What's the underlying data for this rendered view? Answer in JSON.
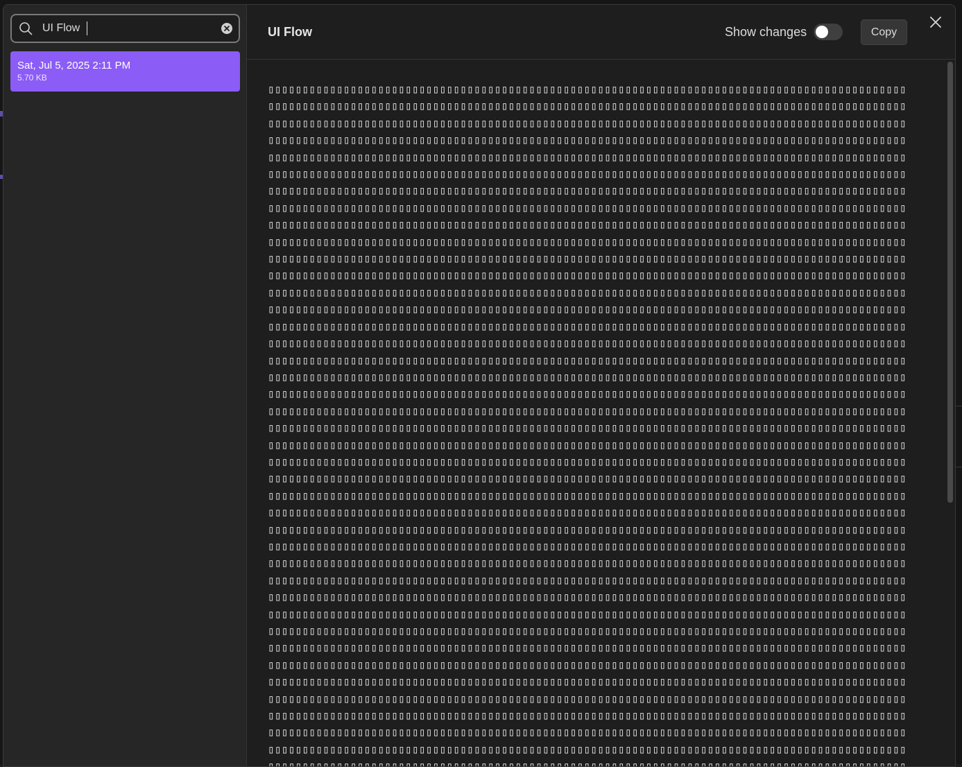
{
  "search": {
    "value": "UI Flow",
    "placeholder": "Search"
  },
  "history": {
    "items": [
      {
        "date": "Sat, Jul 5, 2025 2:11 PM",
        "size": "5.70 KB",
        "selected": true
      }
    ]
  },
  "header": {
    "title": "UI Flow",
    "show_changes_label": "Show changes",
    "show_changes_on": false,
    "copy_label": "Copy"
  },
  "content": {
    "text": "▯▯▯▯▯▯▯▯▯▯▯▯▯▯▯▯▯▯▯▯▯▯▯▯▯▯▯▯▯▯▯▯▯▯▯▯▯▯▯▯▯▯▯▯▯▯▯▯▯▯▯▯▯▯▯▯▯▯▯▯▯▯▯▯▯▯▯▯▯▯▯▯▯▯▯▯▯▯▯▯▯▯▯▯▯▯▯▯▯▯▯▯▯"
  },
  "colors": {
    "accent": "#8b5cf6",
    "background": "#1e1e1e",
    "sidebar": "#262626",
    "text": "#e6e6e6"
  }
}
